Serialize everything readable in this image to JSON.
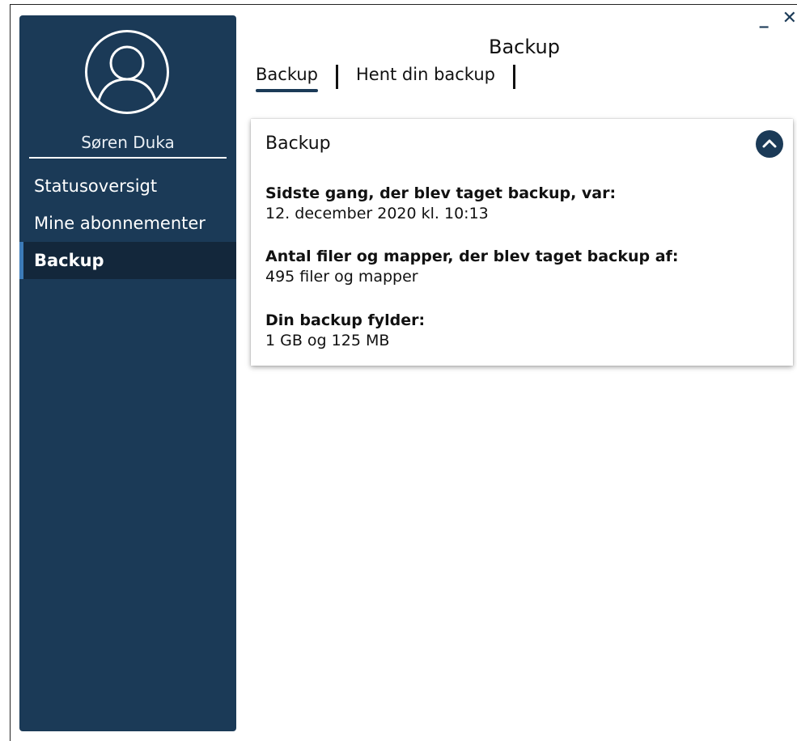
{
  "sidebar": {
    "username": "Søren Duka",
    "items": [
      {
        "label": "Statusoversigt"
      },
      {
        "label": "Mine abonnementer"
      },
      {
        "label": "Backup"
      }
    ]
  },
  "window_controls": {
    "minimize": "_",
    "close": "✕"
  },
  "header": {
    "title": "Backup"
  },
  "tabs": [
    {
      "label": "Backup"
    },
    {
      "label": "Hent din backup"
    }
  ],
  "panel": {
    "title": "Backup",
    "collapse_icon": "chevron-up-icon",
    "fields": [
      {
        "label": "Sidste gang, der blev taget backup, var:",
        "value": "12. december 2020 kl. 10:13"
      },
      {
        "label": "Antal filer og mapper, der blev taget backup af:",
        "value": "495 filer og mapper"
      },
      {
        "label": "Din backup fylder:",
        "value": "1 GB og 125 MB"
      }
    ]
  },
  "colors": {
    "sidebar": "#1b3a57",
    "active_item": "#13273b"
  }
}
